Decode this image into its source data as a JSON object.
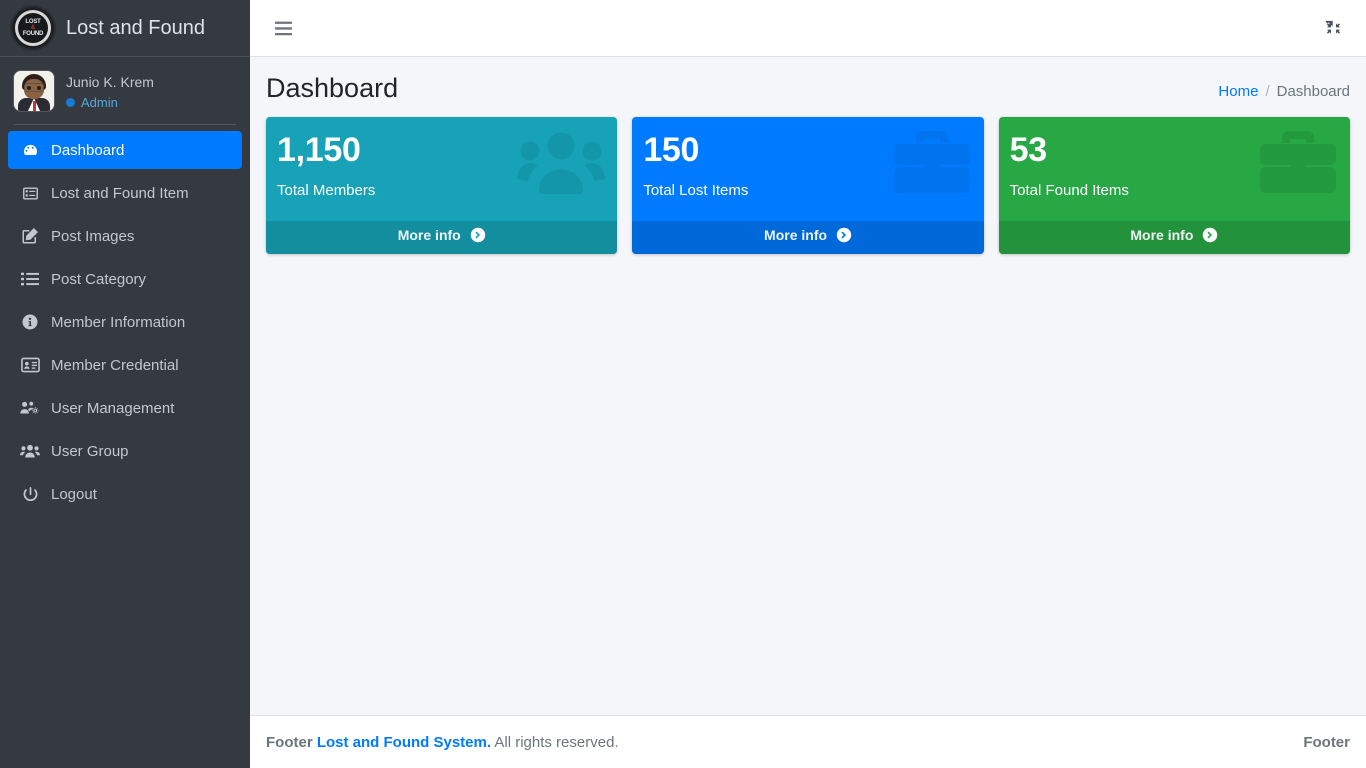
{
  "colors": {
    "sidebar_bg": "#343a40",
    "accent_blue": "#007bff",
    "card_teal": "#17a2b8",
    "card_blue": "#007bff",
    "card_green": "#28a745",
    "content_bg": "#f4f6f9"
  },
  "sidebar": {
    "brand_title": "Lost and Found",
    "brand_logo_icon": "lost-and-found-logo-icon",
    "logo_line1": "LOST",
    "logo_amp": "&",
    "logo_line2": "FOUND",
    "user": {
      "name": "Junio K. Krem",
      "role": "Admin",
      "avatar_icon": "user-avatar"
    },
    "items": [
      {
        "label": "Dashboard",
        "icon": "tachometer-dashboard-icon",
        "active": true
      },
      {
        "label": "Lost and Found Item",
        "icon": "list-alt-icon",
        "active": false
      },
      {
        "label": "Post Images",
        "icon": "edit-pencil-square-icon",
        "active": false
      },
      {
        "label": "Post Category",
        "icon": "list-ul-icon",
        "active": false
      },
      {
        "label": "Member Information",
        "icon": "info-circle-icon",
        "active": false
      },
      {
        "label": "Member Credential",
        "icon": "id-card-icon",
        "active": false
      },
      {
        "label": "User Management",
        "icon": "users-cog-icon",
        "active": false
      },
      {
        "label": "User Group",
        "icon": "users-icon",
        "active": false
      },
      {
        "label": "Logout",
        "icon": "power-off-icon",
        "active": false
      }
    ]
  },
  "navbar": {
    "menu_toggle_icon": "hamburger-menu-icon",
    "fullscreen_icon": "compress-arrows-icon"
  },
  "content_header": {
    "title": "Dashboard",
    "breadcrumb": {
      "home": "Home",
      "separator": "/",
      "current": "Dashboard"
    }
  },
  "cards": [
    {
      "value": "1,150",
      "label": "Total Members",
      "more_info": "More info",
      "icon": "users-group-icon",
      "bg": "#17a2b8",
      "footer_bg": "#138e9f",
      "icon_color": "#0f8499"
    },
    {
      "value": "150",
      "label": "Total Lost Items",
      "more_info": "More info",
      "icon": "briefcase-icon",
      "bg": "#007bff",
      "footer_bg": "#0069d9",
      "icon_color": "#0062cc"
    },
    {
      "value": "53",
      "label": "Total Found Items",
      "more_info": "More info",
      "icon": "briefcase-icon",
      "bg": "#28a745",
      "footer_bg": "#23923d",
      "icon_color": "#1e7e34"
    }
  ],
  "footer": {
    "prefix": "Footer",
    "brand": "Lost and Found System.",
    "rights": "All rights reserved.",
    "right_label": "Footer"
  }
}
